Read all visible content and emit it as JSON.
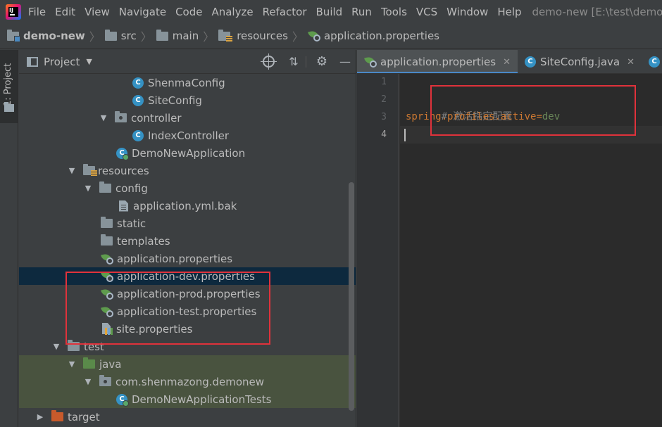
{
  "menubar": {
    "items": [
      "File",
      "Edit",
      "View",
      "Navigate",
      "Code",
      "Analyze",
      "Refactor",
      "Build",
      "Run",
      "Tools",
      "VCS",
      "Window",
      "Help"
    ],
    "title": "demo-new [E:\\test\\demo-new]"
  },
  "breadcrumb": {
    "items": [
      "demo-new",
      "src",
      "main",
      "resources",
      "application.properties"
    ]
  },
  "tool_stripe": {
    "label": "1: Project"
  },
  "project_panel": {
    "title": "Project",
    "tree": [
      {
        "label": "ShenmaConfig",
        "icon": "class-icon"
      },
      {
        "label": "SiteConfig",
        "icon": "class-icon"
      },
      {
        "label": "controller",
        "icon": "package-icon",
        "expanded": true
      },
      {
        "label": "IndexController",
        "icon": "class-icon"
      },
      {
        "label": "DemoNewApplication",
        "icon": "spring-boot-class-icon"
      },
      {
        "label": "resources",
        "icon": "resources-folder-icon",
        "expanded": true
      },
      {
        "label": "config",
        "icon": "folder-icon",
        "expanded": true
      },
      {
        "label": "application.yml.bak",
        "icon": "text-file-icon"
      },
      {
        "label": "static",
        "icon": "folder-icon"
      },
      {
        "label": "templates",
        "icon": "folder-icon"
      },
      {
        "label": "application.properties",
        "icon": "spring-properties-icon"
      },
      {
        "label": "application-dev.properties",
        "icon": "spring-properties-icon",
        "selected": true
      },
      {
        "label": "application-prod.properties",
        "icon": "spring-properties-icon"
      },
      {
        "label": "application-test.properties",
        "icon": "spring-properties-icon"
      },
      {
        "label": "site.properties",
        "icon": "properties-file-icon"
      },
      {
        "label": "test",
        "icon": "folder-icon",
        "expanded": true
      },
      {
        "label": "java",
        "icon": "test-source-folder-icon",
        "expanded": true
      },
      {
        "label": "com.shenmazong.demonew",
        "icon": "package-icon",
        "expanded": true
      },
      {
        "label": "DemoNewApplicationTests",
        "icon": "spring-boot-class-icon"
      },
      {
        "label": "target",
        "icon": "excluded-folder-icon",
        "expanded": false
      }
    ]
  },
  "editor": {
    "tabs": [
      {
        "label": "application.properties",
        "icon": "spring-properties-icon",
        "active": true
      },
      {
        "label": "SiteConfig.java",
        "icon": "class-icon",
        "active": false
      }
    ],
    "line_numbers": [
      "1",
      "2",
      "3",
      "4"
    ],
    "code": {
      "comment": "# 激活指定配置",
      "key": "spring.profiles.active",
      "eq": "=",
      "value": "dev"
    }
  },
  "colors": {
    "highlight_box": "#e0323b",
    "selection": "#0d293e",
    "tab_underline": "#4a88c7"
  }
}
